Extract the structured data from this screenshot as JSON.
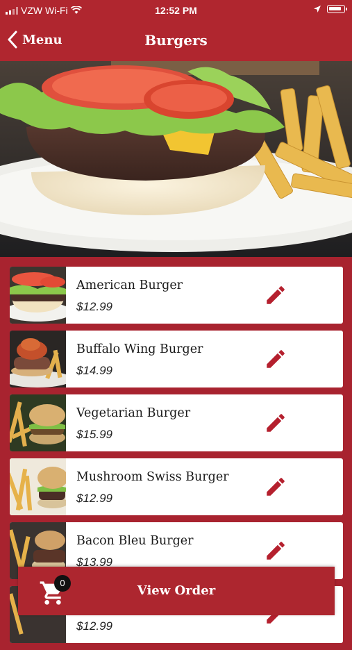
{
  "status_bar": {
    "carrier": "VZW Wi-Fi",
    "time": "12:52 PM"
  },
  "nav": {
    "back_label": "Menu",
    "title": "Burgers"
  },
  "items": [
    {
      "name": "American Burger",
      "price": "$12.99"
    },
    {
      "name": "Buffalo Wing Burger",
      "price": "$14.99"
    },
    {
      "name": "Vegetarian Burger",
      "price": "$15.99"
    },
    {
      "name": "Mushroom Swiss Burger",
      "price": "$12.99"
    },
    {
      "name": "Bacon Bleu Burger",
      "price": "$13.99"
    },
    {
      "name": "",
      "price": "$12.99"
    }
  ],
  "cart": {
    "count": "0",
    "label": "View Order"
  },
  "colors": {
    "brand": "#b0262f",
    "background": "#a8232f"
  }
}
